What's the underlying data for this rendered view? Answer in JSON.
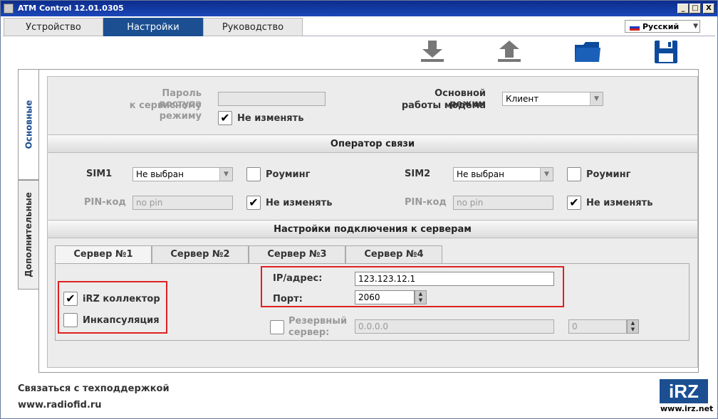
{
  "window": {
    "title": "ATM Control 12.01.0305",
    "btn_min": "_",
    "btn_max": "□",
    "btn_close": "X"
  },
  "menu": {
    "tabs": [
      {
        "label": "Устройство"
      },
      {
        "label": "Настройки"
      },
      {
        "label": "Руководство"
      }
    ],
    "active": 1
  },
  "language": {
    "value": "Русский"
  },
  "toolbar": [
    "download-icon",
    "upload-icon",
    "folder-icon",
    "save-icon"
  ],
  "side_tabs": [
    {
      "label": "Основные"
    },
    {
      "label": "Дополнительные"
    }
  ],
  "general": {
    "password_label_1": "Пароль доступа",
    "password_label_2": "к сервисному режиму",
    "password_value": "",
    "no_change_label": "Не изменять",
    "no_change_checked": true,
    "modem_mode_label_1": "Основной режим",
    "modem_mode_label_2": "работы модема",
    "modem_mode_value": "Клиент"
  },
  "operator": {
    "title": "Оператор связи",
    "sim1": {
      "label": "SIM1",
      "value": "Не выбран",
      "roaming_label": "Роуминг",
      "roaming_checked": false,
      "pin_label": "PIN-код",
      "pin_placeholder": "no pin",
      "no_change_label": "Не изменять",
      "no_change_checked": true
    },
    "sim2": {
      "label": "SIM2",
      "value": "Не выбран",
      "roaming_label": "Роуминг",
      "roaming_checked": false,
      "pin_label": "PIN-код",
      "pin_placeholder": "no pin",
      "no_change_label": "Не изменять",
      "no_change_checked": true
    }
  },
  "servers": {
    "title": "Настройки подключения к серверам",
    "tabs": [
      {
        "label": "Сервер №1"
      },
      {
        "label": "Сервер №2"
      },
      {
        "label": "Сервер №3"
      },
      {
        "label": "Сервер №4"
      }
    ],
    "active": 0,
    "irz_collector_label": "iRZ коллектор",
    "irz_collector_checked": true,
    "encapsulation_label": "Инкапсуляция",
    "encapsulation_checked": false,
    "ip_label": "IP/адрес:",
    "ip_value": "123.123.12.1",
    "port_label": "Порт:",
    "port_value": "2060",
    "backup_label_1": "Резервный",
    "backup_label_2": "сервер:",
    "backup_checked": false,
    "backup_ip": "0.0.0.0",
    "backup_port": "0"
  },
  "footer": {
    "support": "Связаться с техподдержкой",
    "site": "www.radiofid.ru",
    "logo_text": "iRZ",
    "logo_url": "www.irz.net"
  }
}
